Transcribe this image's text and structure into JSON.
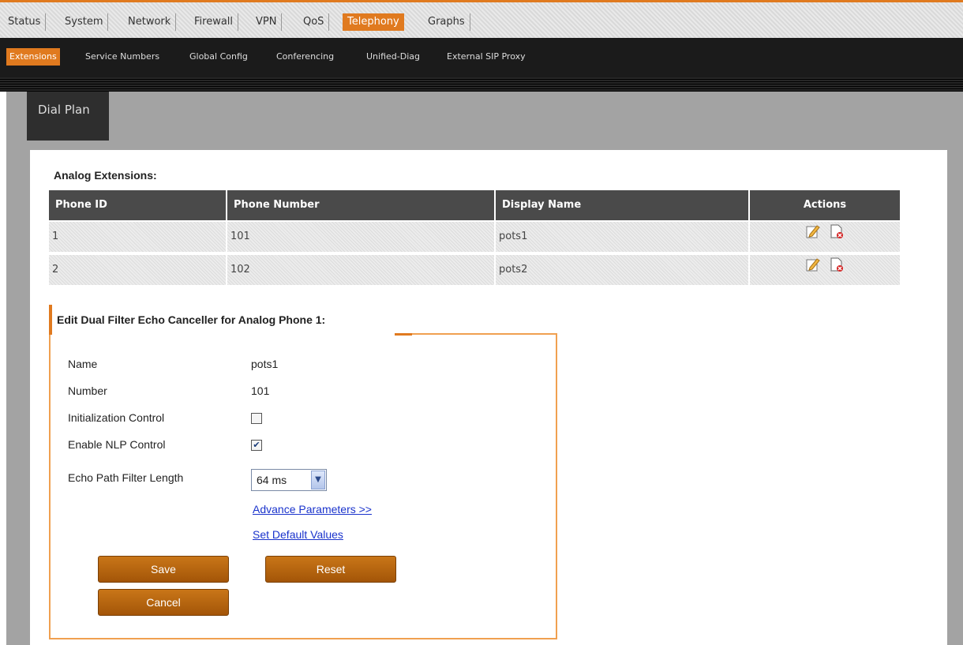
{
  "top_tabs": [
    {
      "label": "Status",
      "active": false
    },
    {
      "label": "System",
      "active": false
    },
    {
      "label": "Network",
      "active": false
    },
    {
      "label": "Firewall",
      "active": false
    },
    {
      "label": "VPN",
      "active": false
    },
    {
      "label": "QoS",
      "active": false
    },
    {
      "label": "Telephony",
      "active": true
    },
    {
      "label": "Graphs",
      "active": false
    }
  ],
  "sub_tabs": [
    {
      "label": "Extensions",
      "active": true
    },
    {
      "label": "Service Numbers",
      "active": false
    },
    {
      "label": "Global Config",
      "active": false
    },
    {
      "label": "Conferencing",
      "active": false
    },
    {
      "label": "Unified-Diag",
      "active": false
    },
    {
      "label": "External SIP Proxy",
      "active": false
    }
  ],
  "page_tab": "Dial Plan",
  "analog_extensions": {
    "title": "Analog Extensions:",
    "columns": [
      "Phone ID",
      "Phone Number",
      "Display Name",
      "Actions"
    ],
    "rows": [
      {
        "phone_id": "1",
        "phone_number": "101",
        "display_name": "pots1",
        "actions": [
          "edit-icon",
          "delete-icon"
        ]
      },
      {
        "phone_id": "2",
        "phone_number": "102",
        "display_name": "pots2",
        "actions": [
          "edit-icon",
          "delete-icon"
        ]
      }
    ]
  },
  "edit_panel": {
    "title": "Edit Dual Filter Echo Canceller for Analog Phone 1:",
    "name_label": "Name",
    "name_value": "pots1",
    "number_label": "Number",
    "number_value": "101",
    "init_control_label": "Initialization Control",
    "init_control_checked": false,
    "nlp_control_label": "Enable NLP Control",
    "nlp_control_checked": true,
    "filter_length_label": "Echo Path Filter Length",
    "filter_length_value": "64 ms",
    "advance_link": "Advance Parameters >>",
    "default_link": "Set Default Values",
    "save_label": "Save",
    "reset_label": "Reset",
    "cancel_label": "Cancel"
  },
  "colors": {
    "accent": "#e07a1f",
    "nav_dark": "#1b1b1b",
    "header_cell": "#4a4a4a",
    "link": "#1a33cc",
    "button": "#b8650f"
  }
}
